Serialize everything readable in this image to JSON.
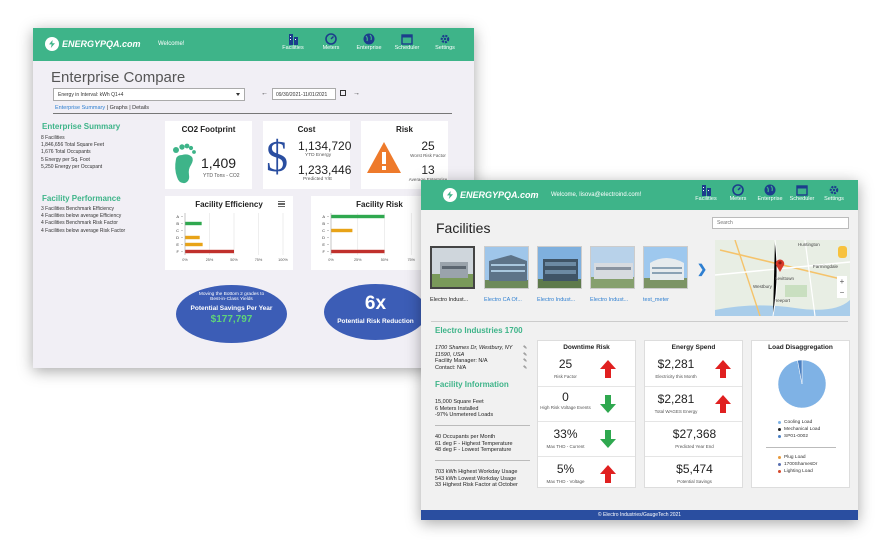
{
  "brand": {
    "logo_text": "ENERGYPQA.com",
    "accent": "#3eb489",
    "link": "#2e7fd1"
  },
  "back_window": {
    "welcome": "Welcome!",
    "nav": [
      "Facilities",
      "Meters",
      "Enterprise",
      "Scheduler",
      "Settings"
    ],
    "title": "Enterprise Compare",
    "select_value": "Energy in Interval: kWh Q1+4",
    "date_range": "09/30/2021-11/01/2021",
    "tabs": {
      "active": "Enterprise Summary",
      "rest": " | Graphs | Details"
    },
    "summary": {
      "heading": "Enterprise Summary",
      "items": [
        "8 Facilities",
        "1,846,656 Total Square Feet",
        "1,676 Total Occupants",
        "5 Energy per Sq. Foot",
        "5,250 Energy per Occupant"
      ]
    },
    "performance": {
      "heading": "Facility Performance",
      "items": [
        "3 Facilities Benchmark Efficiency",
        "4 Facilities below average Efficiency",
        "4 Facilities Benchmark Risk Factor",
        "4 Facilities below average Risk Factor"
      ]
    },
    "co2": {
      "title": "CO2 Footprint",
      "value": "1,409",
      "label": "YTD Tons - CO2"
    },
    "cost": {
      "title": "Cost",
      "value1": "1,134,720",
      "label1": "YTD Energy",
      "value2": "1,233,446",
      "label2": "Predicted Y/E"
    },
    "risk": {
      "title": "Risk",
      "value1": "25",
      "label1": "Worst Risk Factor",
      "value2": "13",
      "label2": "Average Enterprise Risk"
    },
    "efficiency_chart": {
      "title": "Facility Efficiency"
    },
    "risk_chart": {
      "title": "Facility Risk"
    },
    "savings": {
      "line1": "Moving the Bottom 2 grades to",
      "line2": "Best-in-Class Yields",
      "line3": "Potential Savings Per Year",
      "amount": "$177,797"
    },
    "risk_reduction": {
      "value": "6x",
      "label": "Potential Risk Reduction"
    }
  },
  "chart_data": [
    {
      "type": "bar",
      "title": "Facility Efficiency",
      "categories": [
        "A",
        "B",
        "C",
        "D",
        "E",
        "F"
      ],
      "values": [
        0,
        17,
        0,
        15,
        18,
        50
      ],
      "colors": [
        "#2fa84f",
        "#2fa84f",
        "#2fa84f",
        "#e8a317",
        "#e8a317",
        "#c0302c"
      ],
      "x_ticks": [
        "0%",
        "25%",
        "50%",
        "75%",
        "100%"
      ],
      "xlim": [
        0,
        100
      ]
    },
    {
      "type": "bar",
      "title": "Facility Risk",
      "categories": [
        "A",
        "B",
        "C",
        "D",
        "E",
        "F"
      ],
      "values": [
        50,
        0,
        20,
        0,
        0,
        50
      ],
      "colors": [
        "#2fa84f",
        "#2fa84f",
        "#e8a317",
        "#e8a317",
        "#c0302c",
        "#c0302c"
      ],
      "x_ticks": [
        "0%",
        "25%",
        "50%",
        "75%",
        "100%"
      ],
      "xlim": [
        0,
        100
      ]
    },
    {
      "type": "pie",
      "title": "Load Disaggregation",
      "slices": [
        {
          "name": "dominant load",
          "value": 97,
          "color": "#7fb2e5"
        },
        {
          "name": "other",
          "value": 3,
          "color": "#4a7fc1"
        }
      ]
    }
  ],
  "front_window": {
    "welcome": "Welcome, lisova@electroind.com!",
    "nav": [
      "Facilities",
      "Meters",
      "Enterprise",
      "Scheduler",
      "Settings"
    ],
    "title": "Facilities",
    "search_placeholder": "Search",
    "thumbs": [
      "Electro Indust...",
      "Electro CA Of...",
      "Electro Indust...",
      "Electro Indust...",
      "test_meter"
    ],
    "map_labels": [
      "Huntington",
      "Farmingdale",
      "Westbury",
      "Freeport",
      "Levittown"
    ],
    "facility": {
      "name": "Electro Industries 1700",
      "address1": "1700 Shames Dr, Westbury, NY",
      "address2": "11590, USA",
      "manager": "Facility Manager: N/A",
      "contact": "Contact: N/A"
    },
    "info": {
      "heading": "Facility Information",
      "group1": [
        "15,000 Square Feet",
        "6 Meters Installed",
        "-97% Unmetered Loads"
      ],
      "group2": [
        "40 Occupants per Month",
        "61 deg F - Highest Temperature",
        "48 deg F - Lowest Temperature"
      ],
      "group3": [
        "703 kWh Highest Workday Usage",
        "543 kWh Lowest Workday Usage",
        "33 Highest Risk Factor at October"
      ]
    },
    "downtime": {
      "title": "Downtime Risk",
      "rows": [
        {
          "value": "25",
          "label": "Risk Factor",
          "dir": "up"
        },
        {
          "value": "0",
          "label": "High Risk Voltage Events",
          "dir": "down"
        },
        {
          "value": "33%",
          "label": "Max THD - Current",
          "dir": "down"
        },
        {
          "value": "5%",
          "label": "Max THD - Voltage",
          "dir": "up"
        }
      ]
    },
    "spend": {
      "title": "Energy Spend",
      "rows": [
        {
          "value": "$2,281",
          "label": "Electricity this Month",
          "dir": "up"
        },
        {
          "value": "$2,281",
          "label": "Total WAGES Energy",
          "dir": "up"
        },
        {
          "value": "$27,368",
          "label": "Predicted Year End",
          "dir": ""
        },
        {
          "value": "$5,474",
          "label": "Potential Savings",
          "dir": ""
        }
      ]
    },
    "disagg": {
      "title": "Load Disaggregation",
      "legend_a": [
        {
          "name": "Cooling Load",
          "color": "#7fb2e5"
        },
        {
          "name": "Mechanical Load",
          "color": "#222222"
        },
        {
          "name": "SP01-0002",
          "color": "#4a7fc1"
        }
      ],
      "legend_b": [
        {
          "name": "Plug Load",
          "color": "#e89a3c"
        },
        {
          "name": "1700ShamesDr",
          "color": "#5a6fb0"
        },
        {
          "name": "Lighting Load",
          "color": "#d5492d"
        }
      ]
    },
    "footer": "© Electro Industries/GaugeTech 2021"
  }
}
